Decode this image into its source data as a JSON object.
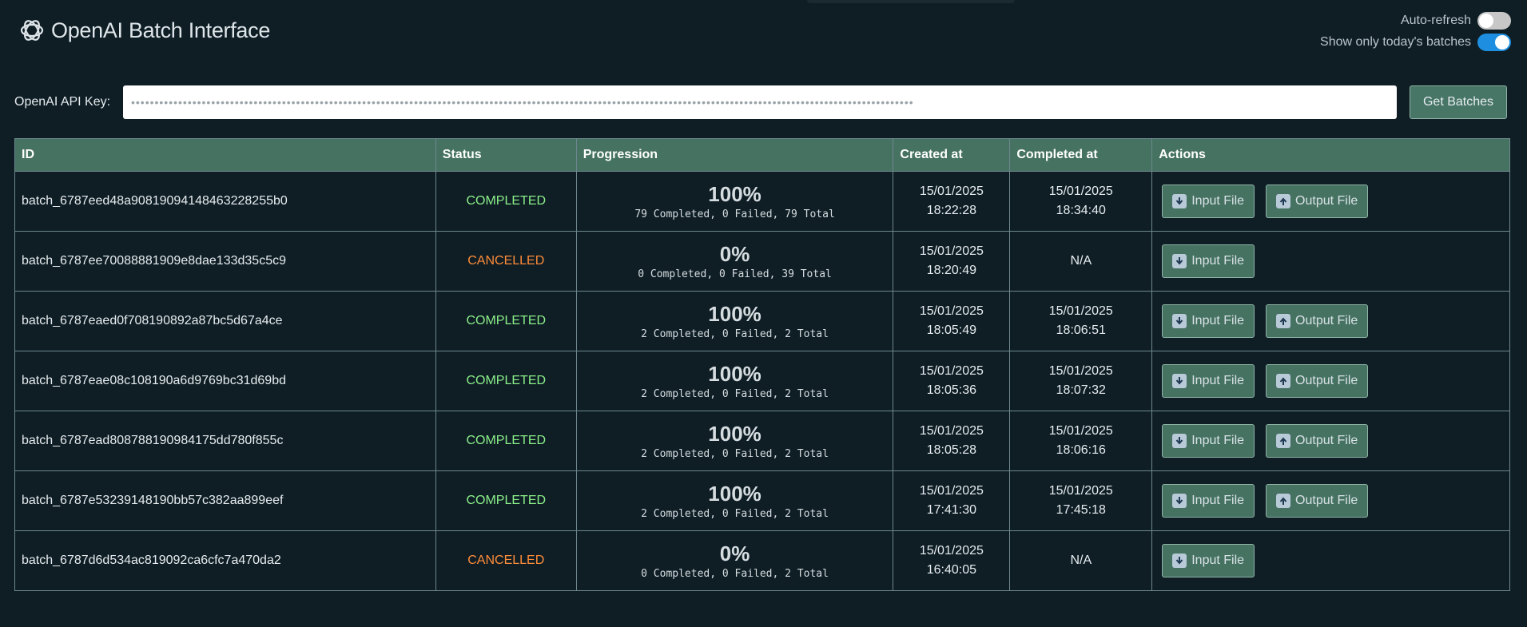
{
  "app": {
    "title": "OpenAI Batch Interface",
    "logo_icon": "openai-logo-icon"
  },
  "toggles": {
    "auto_refresh": {
      "label": "Auto-refresh",
      "on": false
    },
    "today_only": {
      "label": "Show only today's batches",
      "on": true
    }
  },
  "api": {
    "label": "OpenAI API Key:",
    "value": "••••••••••••••••••••••••••••••••••••••••••••••••••••••••••••••••••••••••••••••••••••••••••••••••••••••••••••••••••••••••••••••••••••••••••••••••••••••••••••••••••••••",
    "button": "Get Batches"
  },
  "table": {
    "headers": [
      "ID",
      "Status",
      "Progression",
      "Created at",
      "Completed at",
      "Actions"
    ],
    "input_label": "Input File",
    "output_label": "Output File",
    "rows": [
      {
        "id": "batch_6787eed48a908190941484632282 55b0",
        "status": "COMPLETED",
        "pct": "100%",
        "detail": "79 Completed, 0 Failed, 79 Total",
        "created_date": "15/01/2025",
        "created_time": "18:22:28",
        "completed_date": "15/01/2025",
        "completed_time": "18:34:40",
        "has_output": true
      },
      {
        "id": "batch_6787ee70088881909e8dae133d35c5c9",
        "status": "CANCELLED",
        "pct": "0%",
        "detail": "0 Completed, 0 Failed, 39 Total",
        "created_date": "15/01/2025",
        "created_time": "18:20:49",
        "completed_date": "N/A",
        "completed_time": "",
        "has_output": false
      },
      {
        "id": "batch_6787eaed0f708190892a87bc5d67a4ce",
        "status": "COMPLETED",
        "pct": "100%",
        "detail": "2 Completed, 0 Failed, 2 Total",
        "created_date": "15/01/2025",
        "created_time": "18:05:49",
        "completed_date": "15/01/2025",
        "completed_time": "18:06:51",
        "has_output": true
      },
      {
        "id": "batch_6787eae08c108190a6d9769bc31d69bd",
        "status": "COMPLETED",
        "pct": "100%",
        "detail": "2 Completed, 0 Failed, 2 Total",
        "created_date": "15/01/2025",
        "created_time": "18:05:36",
        "completed_date": "15/01/2025",
        "completed_time": "18:07:32",
        "has_output": true
      },
      {
        "id": "batch_6787ead808788190984175dd780f855c",
        "status": "COMPLETED",
        "pct": "100%",
        "detail": "2 Completed, 0 Failed, 2 Total",
        "created_date": "15/01/2025",
        "created_time": "18:05:28",
        "completed_date": "15/01/2025",
        "completed_time": "18:06:16",
        "has_output": true
      },
      {
        "id": "batch_6787e53239148190bb57c382aa899eef",
        "status": "COMPLETED",
        "pct": "100%",
        "detail": "2 Completed, 0 Failed, 2 Total",
        "created_date": "15/01/2025",
        "created_time": "17:41:30",
        "completed_date": "15/01/2025",
        "completed_time": "17:45:18",
        "has_output": true
      },
      {
        "id": "batch_6787d6d534ac819092ca6cfc7a470da2",
        "status": "CANCELLED",
        "pct": "0%",
        "detail": "0 Completed, 0 Failed, 2 Total",
        "created_date": "15/01/2025",
        "created_time": "16:40:05",
        "completed_date": "N/A",
        "completed_time": "",
        "has_output": false
      }
    ]
  },
  "colors": {
    "background": "#0f1e25",
    "header_row": "#467262",
    "completed": "#8cf08a",
    "cancelled": "#ff8c3a",
    "toggle_on": "#1e8fe0"
  }
}
